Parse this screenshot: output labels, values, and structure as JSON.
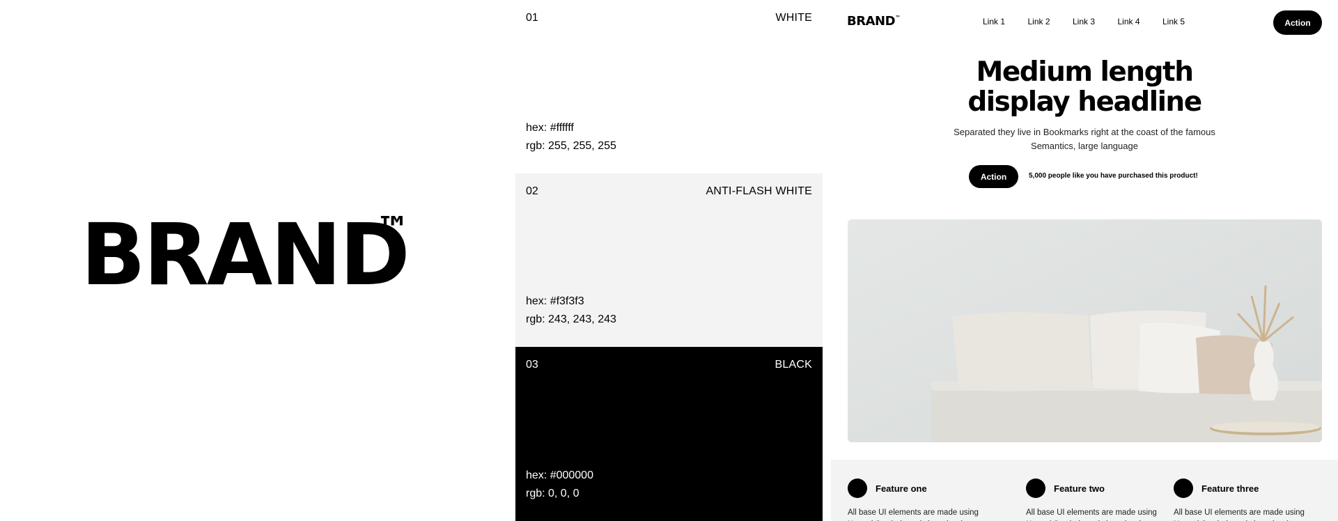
{
  "brand_panel": {
    "logo_text": "BRAND",
    "logo_mark": "™"
  },
  "swatches": [
    {
      "number": "01",
      "name": "WHITE",
      "hex": "hex: #ffffff",
      "rgb": "rgb: 255, 255, 255",
      "color": "#ffffff"
    },
    {
      "number": "02",
      "name": "ANTI-FLASH WHITE",
      "hex": "hex: #f3f3f3",
      "rgb": "rgb: 243, 243, 243",
      "color": "#f3f3f3"
    },
    {
      "number": "03",
      "name": "BLACK",
      "hex": "hex: #000000",
      "rgb": "rgb: 0, 0, 0",
      "color": "#000000"
    }
  ],
  "site": {
    "nav": {
      "brand": "BRAND",
      "brand_mark": "™",
      "links": [
        "Link 1",
        "Link 2",
        "Link 3",
        "Link 4",
        "Link 5"
      ],
      "action_label": "Action"
    },
    "hero": {
      "title_line1": "Medium length",
      "title_line2": "display headline",
      "subtitle": "Separated they live in Bookmarks right at the coast of the famous Semantics, large language",
      "action_label": "Action",
      "note": "5,000 people like you have purchased this product!"
    },
    "features": [
      {
        "title": "Feature one",
        "description": "All base UI elements are made using Nested Symbols and shared styles"
      },
      {
        "title": "Feature two",
        "description": "All base UI elements are made using Nested Symbols and shared styles"
      },
      {
        "title": "Feature three",
        "description": "All base UI elements are made using Nested Symbols and shared styles"
      }
    ]
  }
}
